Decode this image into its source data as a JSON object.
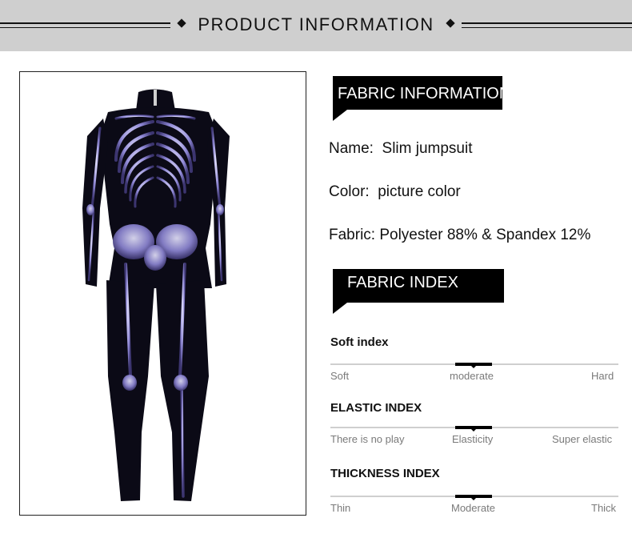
{
  "header": {
    "title": "PRODUCT INFORMATION"
  },
  "product_image": {
    "alt": "skeleton print jumpsuit"
  },
  "fabric_information": {
    "heading": "FABRIC INFORMATION",
    "name": "Name:  Slim jumpsuit",
    "color": "Color:  picture color",
    "fabric": "Fabric: Polyester 88% & Spandex 12%"
  },
  "fabric_index": {
    "heading": "FABRIC INDEX",
    "indexes": [
      {
        "title": "Soft index",
        "low": "Soft",
        "mid": "moderate",
        "high": "Hard",
        "level": "mid"
      },
      {
        "title": "ELASTIC INDEX",
        "low": "There is no play",
        "mid": "Elasticity",
        "high": "Super elastic",
        "level": "mid"
      },
      {
        "title": "THICKNESS INDEX",
        "low": "Thin",
        "mid": "Moderate",
        "high": "Thick",
        "level": "mid"
      }
    ]
  },
  "colors": {
    "banner": "#cfcfcf",
    "tag": "#000000",
    "bone": "#8f88d6"
  }
}
